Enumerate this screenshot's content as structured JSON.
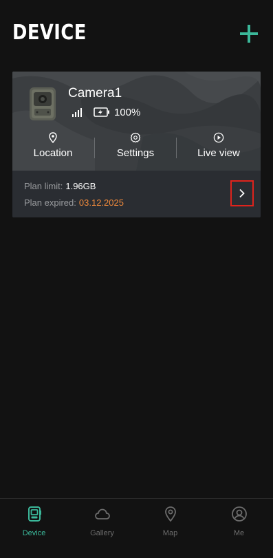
{
  "header": {
    "title": "DEVICE"
  },
  "device_card": {
    "name": "Camera1",
    "battery": "100%",
    "actions": [
      {
        "label": "Location",
        "icon": "location-pin-icon"
      },
      {
        "label": "Settings",
        "icon": "gear-icon"
      },
      {
        "label": "Live view",
        "icon": "play-circle-icon"
      }
    ],
    "plan_limit_label": "Plan limit:",
    "plan_limit_value": "1.96GB",
    "plan_expired_label": "Plan expired:",
    "plan_expired_value": "03.12.2025"
  },
  "tabbar": {
    "tabs": [
      {
        "label": "Device",
        "icon": "device-icon",
        "active": true
      },
      {
        "label": "Gallery",
        "icon": "cloud-icon",
        "active": false
      },
      {
        "label": "Map",
        "icon": "location-pin-icon",
        "active": false
      },
      {
        "label": "Me",
        "icon": "user-circle-icon",
        "active": false
      }
    ]
  },
  "colors": {
    "accent": "#3bb89a",
    "expired": "#f08a3c",
    "highlight": "#e0231c",
    "background": "#121212"
  }
}
